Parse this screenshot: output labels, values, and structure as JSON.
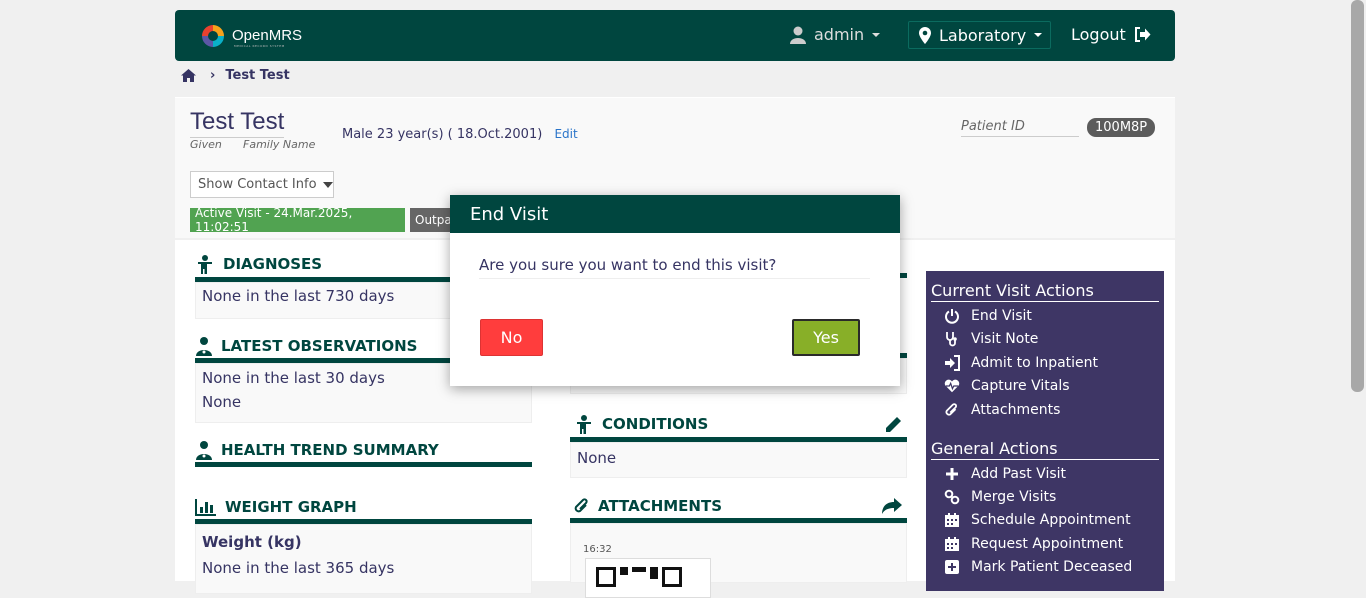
{
  "header": {
    "logo_text": "OpenMRS",
    "logo_subtext": "MEDICAL RECORD SYSTEM",
    "user": "admin",
    "location": "Laboratory",
    "logout": "Logout"
  },
  "breadcrumb": {
    "current": "Test Test"
  },
  "patient": {
    "name": "Test Test",
    "given_label": "Given",
    "family_label": "Family Name",
    "demographics": "Male  23 year(s) ( 18.Oct.2001)",
    "edit": "Edit",
    "patient_id_label": "Patient ID",
    "patient_id": "100M8P",
    "contact_button": "Show Contact Info",
    "active_visit": "Active Visit - 24.Mar.2025, 11:02:51",
    "visit_type": "Outpatient"
  },
  "sections": {
    "diagnoses": {
      "title": "DIAGNOSES",
      "body": "None in the last 730 days"
    },
    "latest_obs": {
      "title": "LATEST OBSERVATIONS",
      "line1": "None in the last 30 days",
      "line2": "None"
    },
    "health_trend": {
      "title": "HEALTH TREND SUMMARY"
    },
    "weight_graph": {
      "title": "WEIGHT GRAPH",
      "subtitle": "Weight (kg)",
      "body": "None in the last 365 days"
    },
    "conditions": {
      "title": "CONDITIONS",
      "body": "None"
    },
    "attachments": {
      "title": "ATTACHMENTS",
      "time": "16:32"
    }
  },
  "sidebar": {
    "current_title": "Current Visit Actions",
    "current_items": [
      {
        "label": "End Visit",
        "icon": "power-icon"
      },
      {
        "label": "Visit Note",
        "icon": "stethoscope-icon"
      },
      {
        "label": "Admit to Inpatient",
        "icon": "signin-icon"
      },
      {
        "label": "Capture Vitals",
        "icon": "heartbeat-icon"
      },
      {
        "label": "Attachments",
        "icon": "paperclip-icon"
      }
    ],
    "general_title": "General Actions",
    "general_items": [
      {
        "label": "Add Past Visit",
        "icon": "plus-icon"
      },
      {
        "label": "Merge Visits",
        "icon": "link-icon"
      },
      {
        "label": "Schedule Appointment",
        "icon": "calendar-icon"
      },
      {
        "label": "Request Appointment",
        "icon": "calendar-icon"
      },
      {
        "label": "Mark Patient Deceased",
        "icon": "plus-square-icon"
      }
    ]
  },
  "modal": {
    "title": "End Visit",
    "question": "Are you sure you want to end this visit?",
    "no": "No",
    "yes": "Yes"
  },
  "colors": {
    "primary": "#00463f",
    "sidebar": "#3e3665",
    "no": "#ff3d3d",
    "yes": "#88af28",
    "active_visit": "#51a351"
  }
}
